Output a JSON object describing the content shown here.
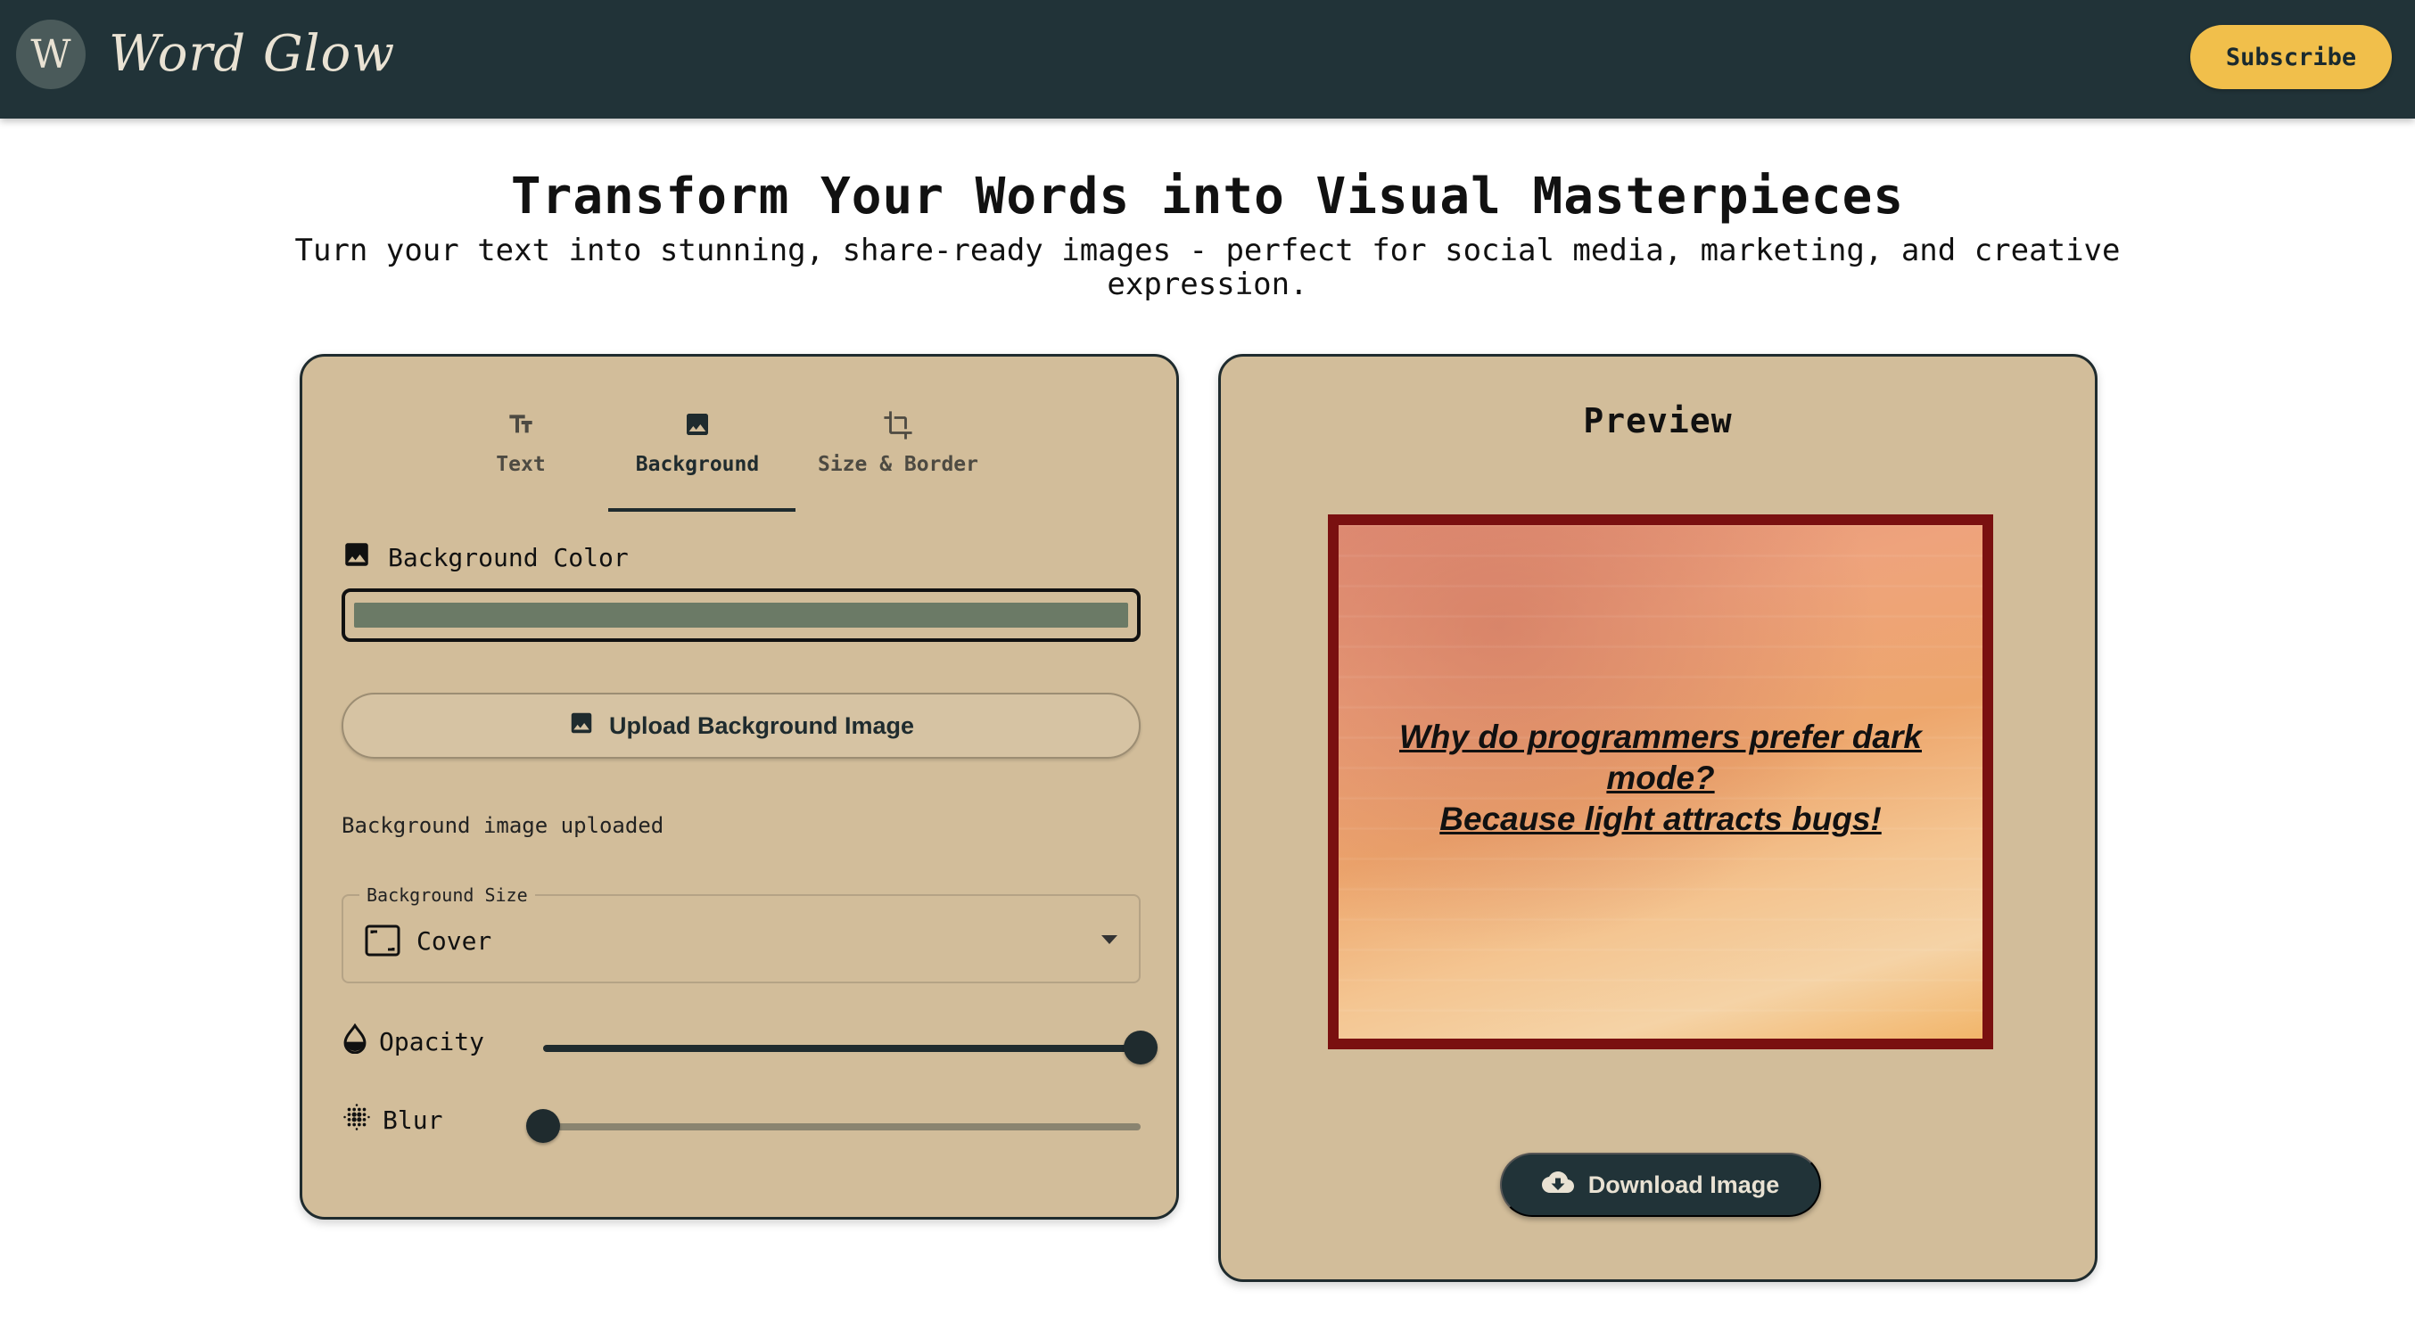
{
  "header": {
    "logo_letter": "W",
    "brand": "Word Glow",
    "subscribe_label": "Subscribe"
  },
  "hero": {
    "title": "Transform Your Words into Visual Masterpieces",
    "subtitle": "Turn your text into stunning, share-ready images - perfect for social media, marketing, and creative expression."
  },
  "editor": {
    "tabs": [
      {
        "label": "Text",
        "icon": "text-fields-icon"
      },
      {
        "label": "Background",
        "icon": "image-icon",
        "active": true
      },
      {
        "label": "Size & Border",
        "icon": "crop-icon"
      }
    ],
    "background_color_label": "Background Color",
    "background_color_value": "#6b7a66",
    "upload_label": "Upload Background Image",
    "upload_status": "Background image uploaded",
    "background_size": {
      "legend": "Background Size",
      "value": "Cover"
    },
    "opacity": {
      "label": "Opacity",
      "value": 1.0
    },
    "blur": {
      "label": "Blur",
      "value": 0.0
    }
  },
  "preview": {
    "title": "Preview",
    "text_line1": "Why do programmers prefer dark mode?",
    "text_line2": "Because light attracts bugs!",
    "border_color": "#7a1010",
    "download_label": "Download Image"
  },
  "colors": {
    "header_bg": "#213338",
    "panel_bg": "#d2bd9a",
    "accent": "#f1bf4b"
  }
}
